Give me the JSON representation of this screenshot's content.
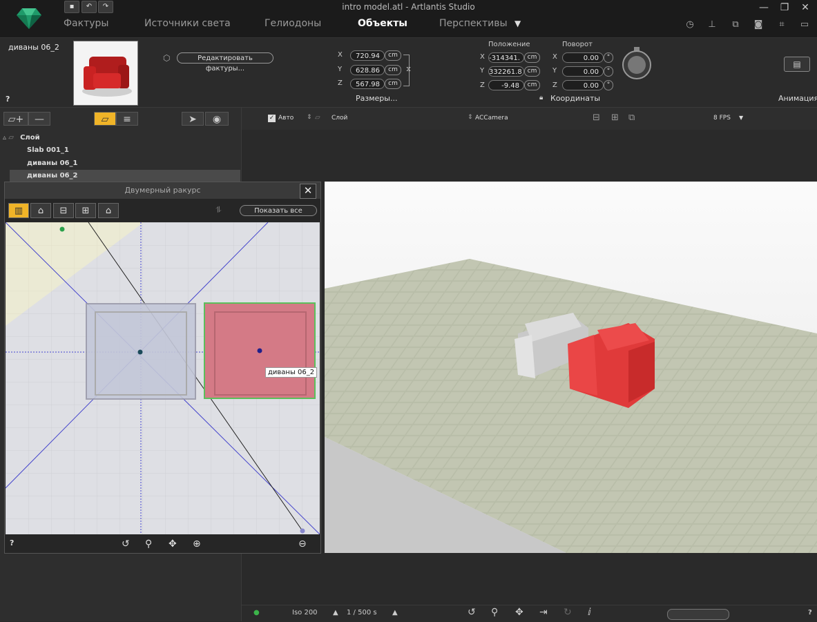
{
  "window": {
    "title": "intro model.atl - Artlantis Studio",
    "minimize": "—",
    "maximize": "❐",
    "close": "✕"
  },
  "nav": {
    "tabs": [
      {
        "label": "Фактуры"
      },
      {
        "label": "Источники света"
      },
      {
        "label": "Гелиодоны"
      },
      {
        "label": "Объекты"
      },
      {
        "label": "Перспективы"
      }
    ],
    "dropdown_glyph": "▼",
    "active_index": 3
  },
  "object": {
    "name": "диваны 06_2",
    "help": "?",
    "edit_textures": "Редактировать фактуры..."
  },
  "size": {
    "x": "720.94",
    "y": "628.86",
    "z": "567.98",
    "unit": "cm",
    "label": "Размеры..."
  },
  "position": {
    "heading": "Положение",
    "x": "-314341.",
    "y": "332261.8",
    "z": "-9.48",
    "unit": "cm"
  },
  "rotation": {
    "heading": "Поворот",
    "x": "0.00",
    "y": "0.00",
    "z": "0.00",
    "unit": "°"
  },
  "axes": {
    "x": "X",
    "y": "Y",
    "z": "Z"
  },
  "coordinates_label": "Координаты",
  "animation_label": "Анимация",
  "layers": {
    "root": "Слой",
    "items": [
      "Slab 001_1",
      "диваны 06_1",
      "диваны 06_2"
    ],
    "selected_index": 2
  },
  "viewport_toolbar": {
    "auto": "Авто",
    "layer": "Слой",
    "camera": "ACCamera",
    "fps": "8 FPS"
  },
  "twod": {
    "title": "Двумерный ракурс",
    "close": "✕",
    "show_all": "Показать все",
    "object_tag": "диваны 06_2",
    "help": "?"
  },
  "status": {
    "iso": "Iso 200",
    "exposure": "1 / 500 s",
    "help": "?"
  },
  "colors": {
    "accent": "#f0b428",
    "selected": "#e0787e",
    "plan_bg": "#e4e4e4"
  }
}
